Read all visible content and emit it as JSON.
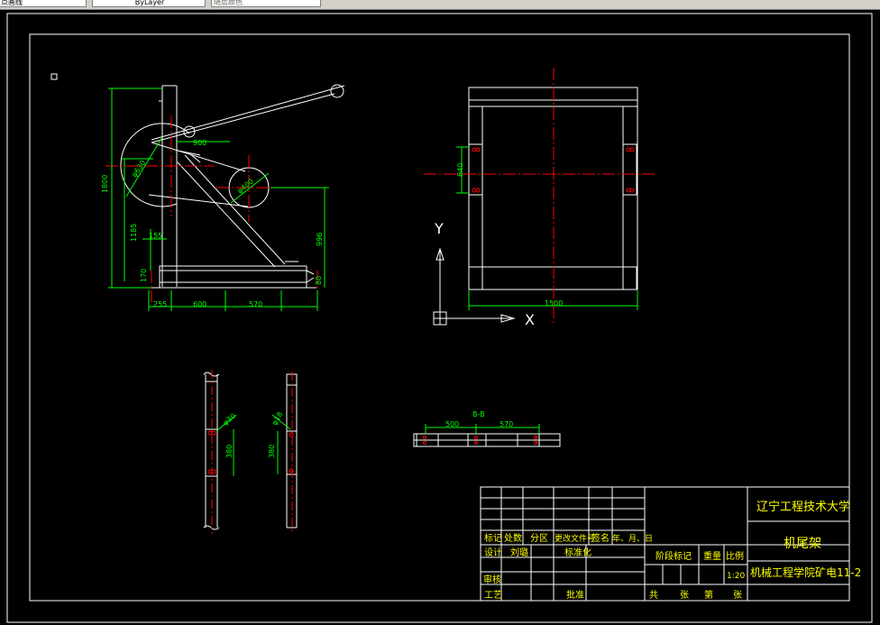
{
  "toolbar": {
    "layer_combo": "点画线",
    "linetype_combo": "ByLayer",
    "lineweight_combo": "随层颜色"
  },
  "colors": {
    "background": "#000000",
    "geometry": "#ffffff",
    "dimension": "#00ff00",
    "centerline": "#ff0000",
    "title_text": "#ffff00"
  },
  "drawing": {
    "main_view_dims": [
      "1800",
      "1185",
      "155",
      "900",
      "φ630",
      "φ400",
      "996",
      "255",
      "600",
      "570",
      "170",
      "80"
    ],
    "top_view_dims": [
      "640",
      "1500"
    ],
    "section_dims": [
      "500",
      "570"
    ],
    "section_label": "B-B",
    "detail_dims": [
      "φ30",
      "380",
      "φ18",
      "380"
    ],
    "ucs": {
      "y": "Y",
      "x": "X"
    }
  },
  "title_block": {
    "school": "辽宁工程技术大学",
    "part_name": "机尾架",
    "class_name": "机械工程学院矿电11-2",
    "headers": [
      "标记",
      "处数",
      "分区",
      "更改文件号",
      "签名",
      "年、月、日"
    ],
    "design": "设计",
    "designer": "刘璐",
    "standardize": "标准化",
    "stage_mark": "阶段标记",
    "weight": "重量",
    "scale_label": "比例",
    "scale_value": "1:20",
    "review": "审核",
    "process": "工艺",
    "approve": "批准",
    "sheet_total": "共",
    "sheet_unit": "张",
    "sheet_num": "第",
    "sheet_unit2": "张"
  }
}
